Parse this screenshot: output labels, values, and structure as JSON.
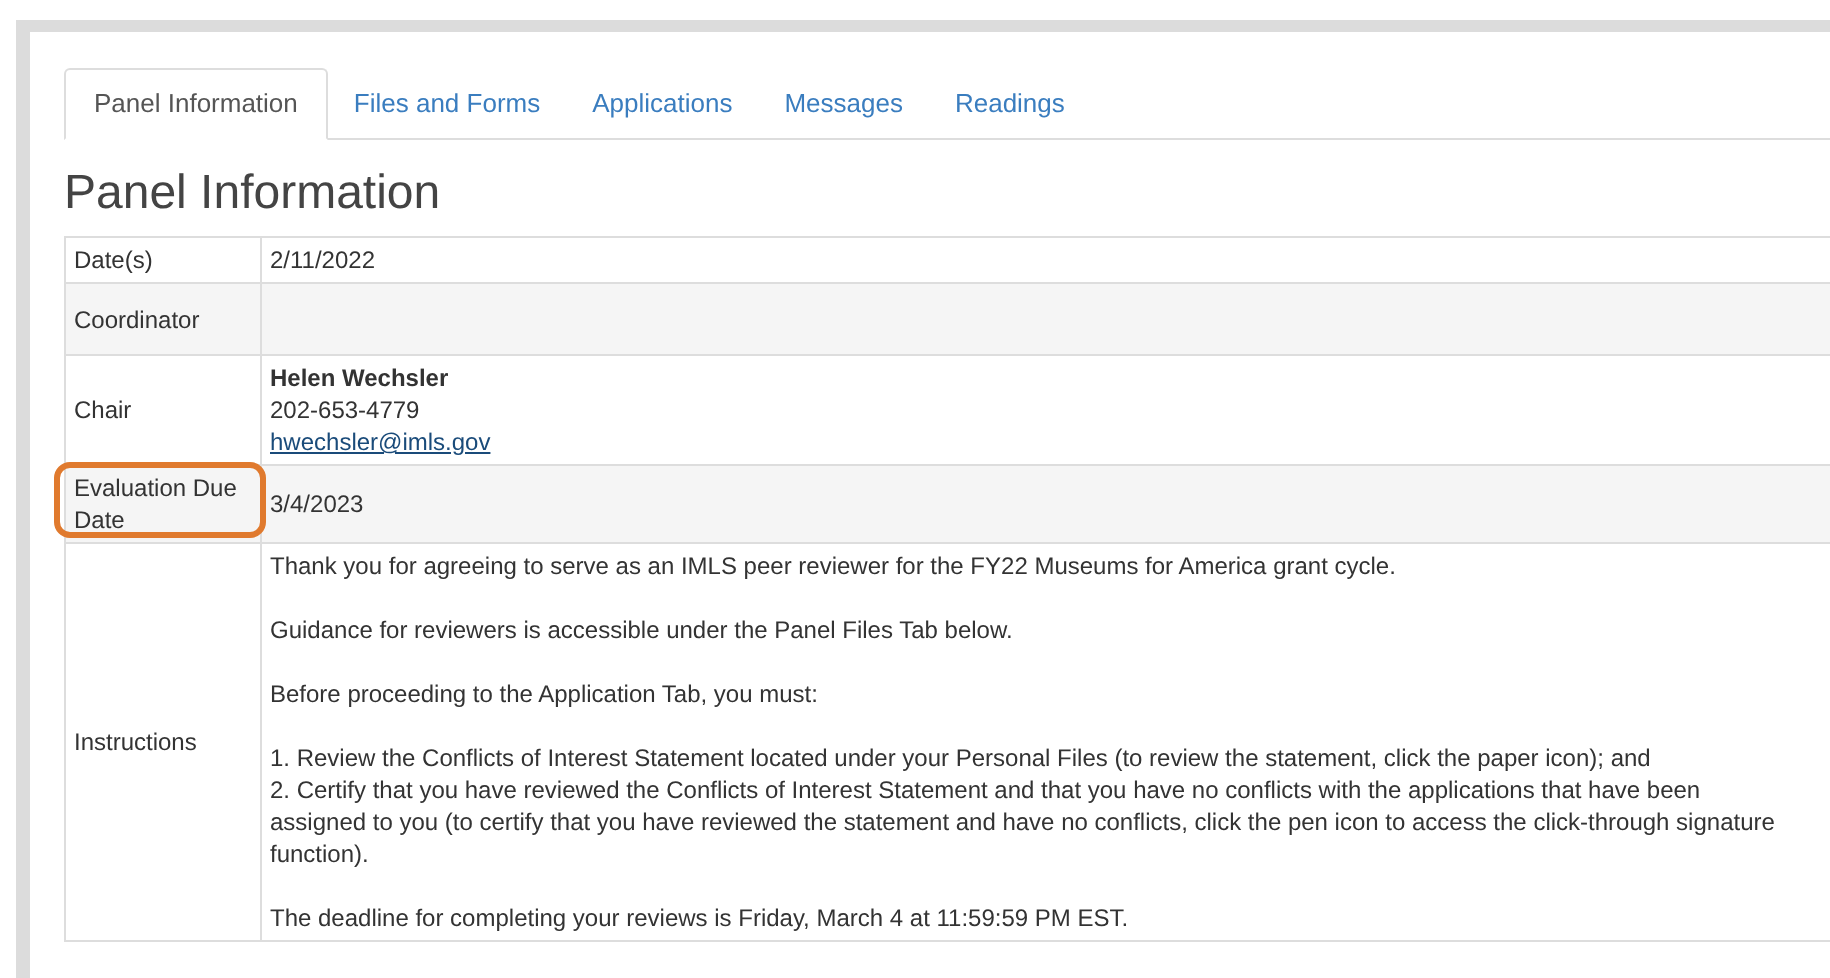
{
  "tabs": [
    {
      "label": "Panel Information",
      "selected": true
    },
    {
      "label": "Files and Forms",
      "selected": false
    },
    {
      "label": "Applications",
      "selected": false
    },
    {
      "label": "Messages",
      "selected": false
    },
    {
      "label": "Readings",
      "selected": false
    }
  ],
  "heading": "Panel Information",
  "rows": [
    {
      "label": "Date(s)",
      "highlighted": false,
      "lines": [
        {
          "kind": "text",
          "text": "2/11/2022"
        }
      ]
    },
    {
      "label": "Coordinator",
      "highlighted": false,
      "lines": []
    },
    {
      "label": "Chair",
      "highlighted": false,
      "lines": [
        {
          "kind": "bold",
          "text": "Helen Wechsler"
        },
        {
          "kind": "text",
          "text": "202-653-4779"
        },
        {
          "kind": "link",
          "text": "hwechsler@imls.gov"
        }
      ]
    },
    {
      "label": "Evaluation Due Date",
      "highlighted": true,
      "lines": [
        {
          "kind": "text",
          "text": "3/4/2023"
        }
      ]
    },
    {
      "label": "Instructions",
      "highlighted": false,
      "paragraphs": [
        [
          "Thank you for agreeing to serve as an IMLS peer reviewer for the FY22 Museums for America grant cycle."
        ],
        [
          "Guidance for reviewers is accessible under the Panel Files Tab below."
        ],
        [
          "Before proceeding to the Application Tab, you must:"
        ],
        [
          "1. Review the Conflicts of Interest Statement located under your Personal Files (to review the statement, click the paper icon); and",
          "2. Certify that you have reviewed the Conflicts of Interest Statement and that you have no conflicts with the applications that have been assigned to you (to certify that you have reviewed the statement and have no conflicts, click the pen icon to access the click-through signature function)."
        ],
        [
          "The deadline for completing your reviews is Friday, March 4 at 11:59:59 PM EST."
        ]
      ]
    }
  ]
}
